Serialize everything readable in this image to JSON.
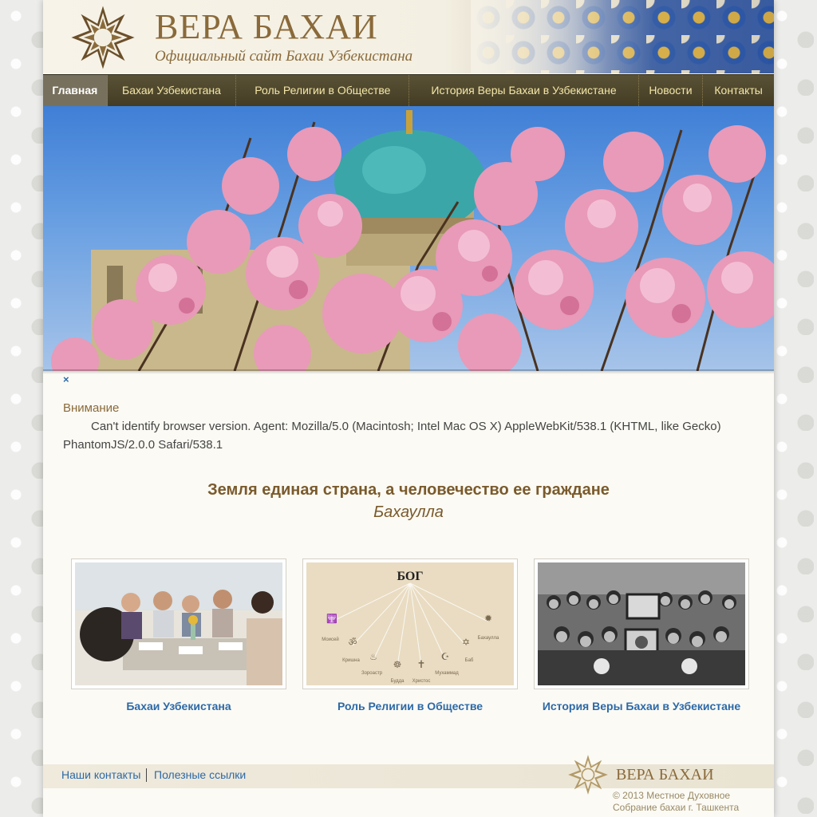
{
  "header": {
    "title": "ВЕРА БАХАИ",
    "subtitle": "Официальный сайт Бахаи Узбекистана"
  },
  "nav": {
    "items": [
      {
        "label": "Главная",
        "active": true
      },
      {
        "label": "Бахаи Узбекистана",
        "active": false
      },
      {
        "label": "Роль Религии в Обществе",
        "active": false
      },
      {
        "label": "История Веры Бахаи в Узбекистане",
        "active": false
      },
      {
        "label": "Новости",
        "active": false
      },
      {
        "label": "Контакты",
        "active": false
      }
    ]
  },
  "notice": {
    "close": "×",
    "title": "Внимание",
    "text": "Can't identify browser version. Agent: Mozilla/5.0 (Macintosh; Intel Mac OS X) AppleWebKit/538.1 (KHTML, like Gecko) PhantomJS/2.0.0 Safari/538.1"
  },
  "quote": {
    "text": "Земля единая страна, а человечество ее граждане",
    "author": "Бахаулла"
  },
  "cards": [
    {
      "caption": "Бахаи Узбекистана"
    },
    {
      "caption": "Роль Религии в Обществе",
      "image_text": {
        "heading": "БОГ",
        "labels": [
          "Моисей",
          "Кришна",
          "Зороастр",
          "Будда",
          "Христос",
          "Мухаммад",
          "Баб",
          "Бахаулла"
        ]
      }
    },
    {
      "caption": "История Веры Бахаи в Узбекистане"
    }
  ],
  "footer": {
    "links": [
      "Наши контакты",
      "Полезные ссылки"
    ],
    "brand": "ВЕРА БАХАИ",
    "copyright_line1": "© 2013 Местное Духовное",
    "copyright_line2": "Собрание бахаи г. Ташкента"
  },
  "colors": {
    "nav_bg": "#4f4730",
    "nav_text": "#f4e6a7",
    "brand": "#8a6a3a",
    "link": "#2c69a8"
  }
}
